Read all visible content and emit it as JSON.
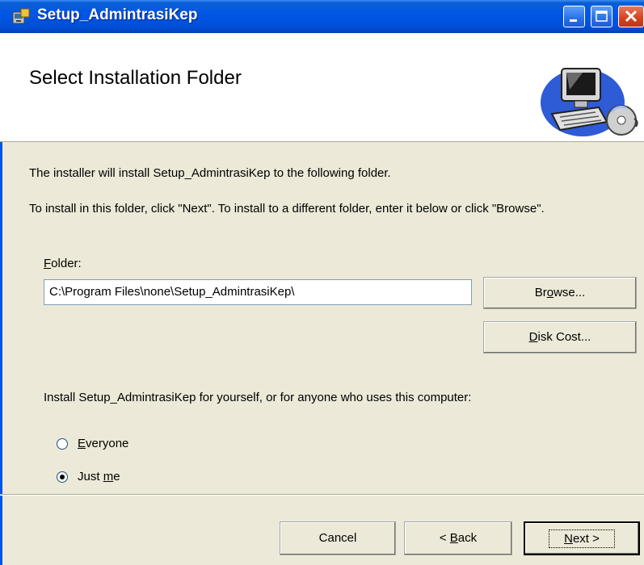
{
  "window": {
    "title": "Setup_AdmintrasiKep"
  },
  "banner": {
    "title": "Select Installation Folder",
    "art_icon": "computer-with-cd-icon"
  },
  "body": {
    "line1": "The installer will install Setup_AdmintrasiKep to the following folder.",
    "line2": "To install in this folder, click \"Next\". To install to a different folder, enter it below or click \"Browse\".",
    "folder_label_first": "F",
    "folder_label_rest": "older:",
    "folder_value": "C:\\Program Files\\none\\Setup_AdmintrasiKep\\",
    "browse_label_a": "Br",
    "browse_label_u": "o",
    "browse_label_b": "wse...",
    "diskcost_label_u": "D",
    "diskcost_label_b": "isk Cost...",
    "install_for": "Install Setup_AdmintrasiKep for yourself, or for anyone who uses this computer:",
    "radio_everyone_u": "E",
    "radio_everyone_b": "veryone",
    "radio_justme_a": "Just ",
    "radio_justme_u": "m",
    "radio_justme_b": "e",
    "selected_radio": "Just me"
  },
  "footer": {
    "cancel_label": "Cancel",
    "back_arrow": "< ",
    "back_u": "B",
    "back_b": "ack",
    "next_u": "N",
    "next_b": "ext >"
  },
  "colors": {
    "titlebar": "#0055e5",
    "dialog_bg": "#ece9d8",
    "close_button": "#d4411c"
  }
}
